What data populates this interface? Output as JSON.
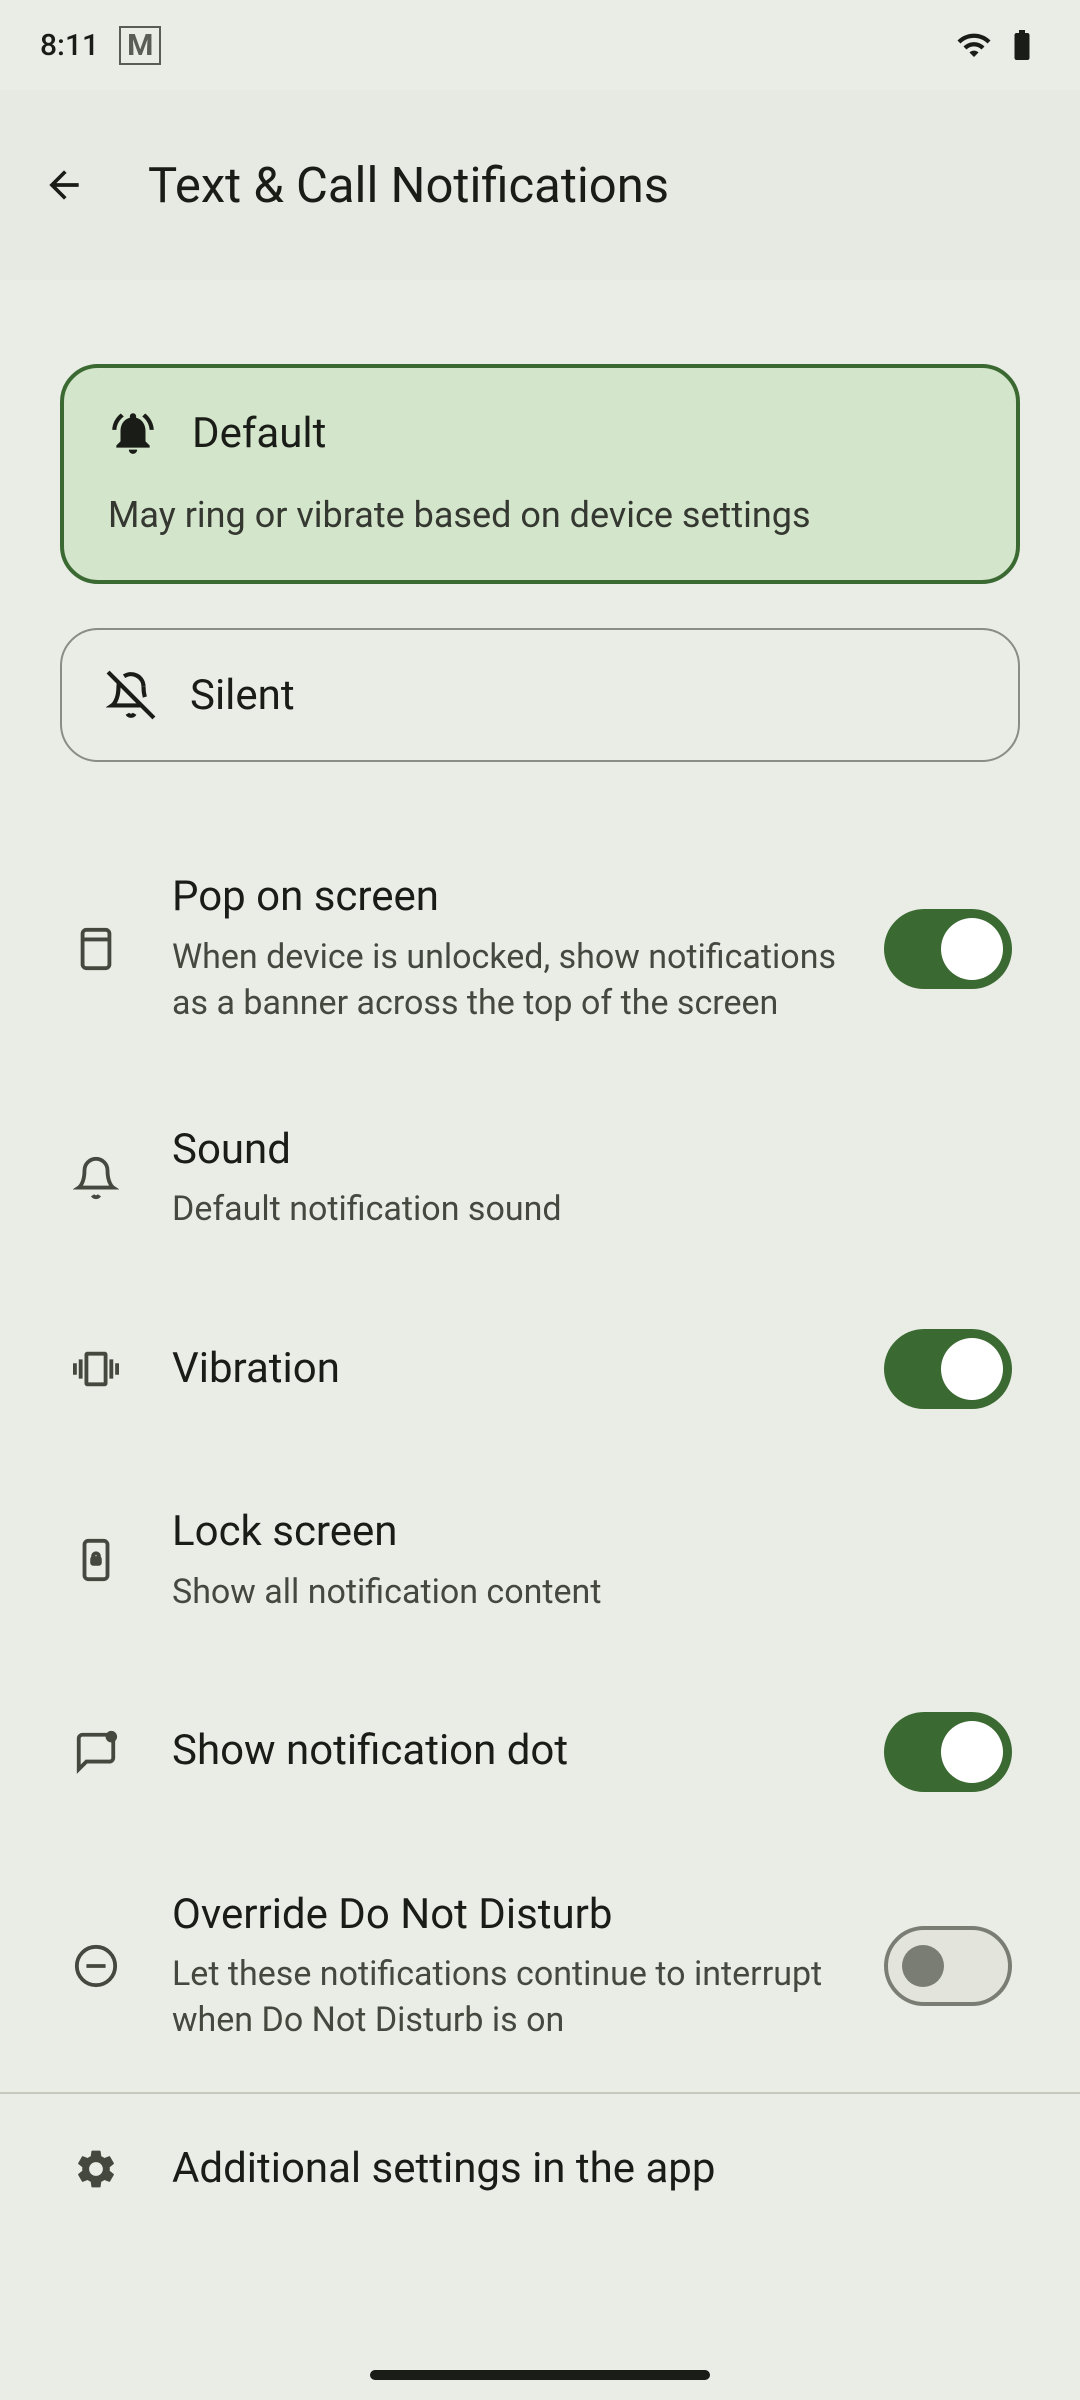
{
  "status": {
    "time": "8:11"
  },
  "header": {
    "title": "Text & Call Notifications"
  },
  "modes": {
    "default": {
      "title": "Default",
      "desc": "May ring or vibrate based on device settings"
    },
    "silent": {
      "title": "Silent"
    }
  },
  "settings": {
    "pop": {
      "title": "Pop on screen",
      "sub": "When device is unlocked, show notifications as a banner across the top of the screen",
      "on": true
    },
    "sound": {
      "title": "Sound",
      "sub": "Default notification sound"
    },
    "vibration": {
      "title": "Vibration",
      "on": true
    },
    "lock": {
      "title": "Lock screen",
      "sub": "Show all notification content"
    },
    "dot": {
      "title": "Show notification dot",
      "on": true
    },
    "dnd": {
      "title": "Override Do Not Disturb",
      "sub": "Let these notifications continue to interrupt when Do Not Disturb is on",
      "on": false
    },
    "additional": {
      "title": "Additional settings in the app"
    }
  }
}
